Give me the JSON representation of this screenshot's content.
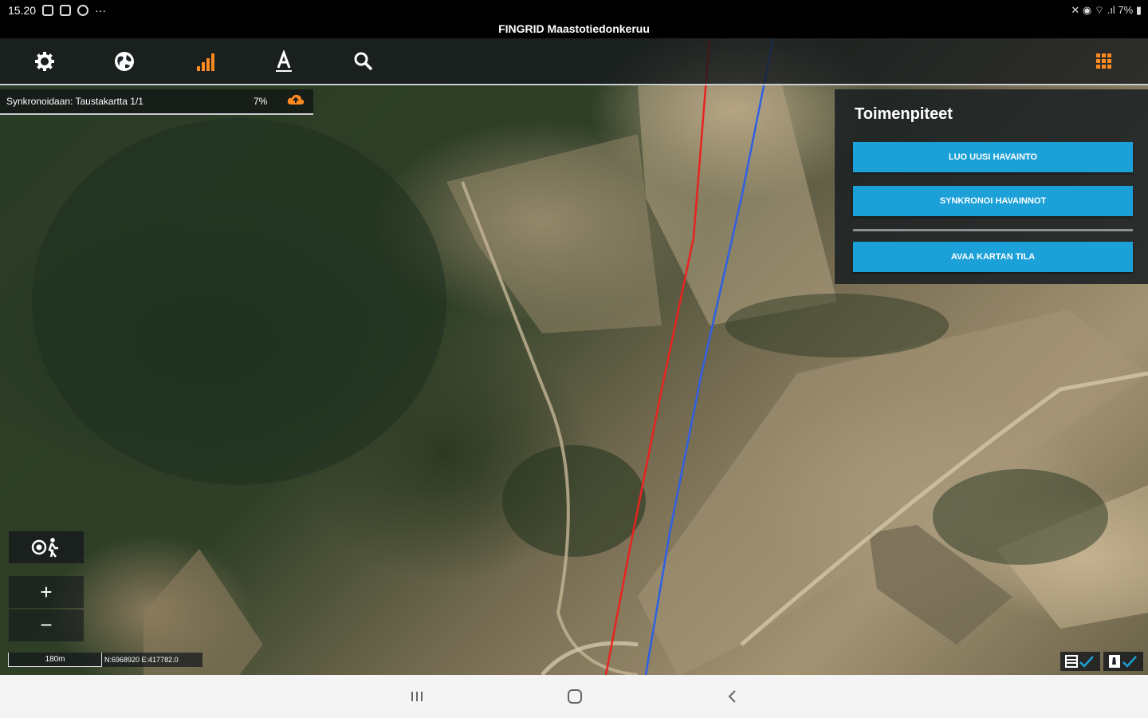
{
  "status_bar": {
    "time": "15.20",
    "more": "···",
    "right": "✕ ◉ ⌔ .ıl 7% ▮"
  },
  "app_title": "FINGRID Maastotiedonkeruu",
  "toolbar": {
    "buttons": [
      {
        "name": "gear-icon",
        "interactable": true
      },
      {
        "name": "globe-icon",
        "interactable": true
      },
      {
        "name": "signal-bars-icon",
        "interactable": true
      },
      {
        "name": "text-tool-icon",
        "interactable": true
      },
      {
        "name": "search-icon",
        "interactable": true
      }
    ],
    "grid_menu": "grid-menu-icon",
    "accent_color": "#ff8a1f"
  },
  "sync": {
    "label": "Synkronoidaan: Taustakartta 1/1",
    "percent": "7%",
    "icon": "cloud-upload-icon"
  },
  "panel": {
    "title": "Toimenpiteet",
    "buttons": [
      "LUO UUSI HAVAINTO",
      "SYNKRONOI HAVAINNOT",
      "AVAA KARTAN TILA"
    ],
    "button_color": "#1ba0d8"
  },
  "map_controls": {
    "location_icon": "location-follow-icon",
    "zoom_in": "+",
    "zoom_out": "−",
    "scale": "180m",
    "coords": "N:6968920 E:417782.0"
  },
  "lines": {
    "red": "#e8231f",
    "blue": "#2f5fe3"
  },
  "layer_buttons": [
    "layers-check-icon",
    "map-check-icon"
  ],
  "nav": [
    "recents-icon",
    "home-icon",
    "back-icon"
  ]
}
